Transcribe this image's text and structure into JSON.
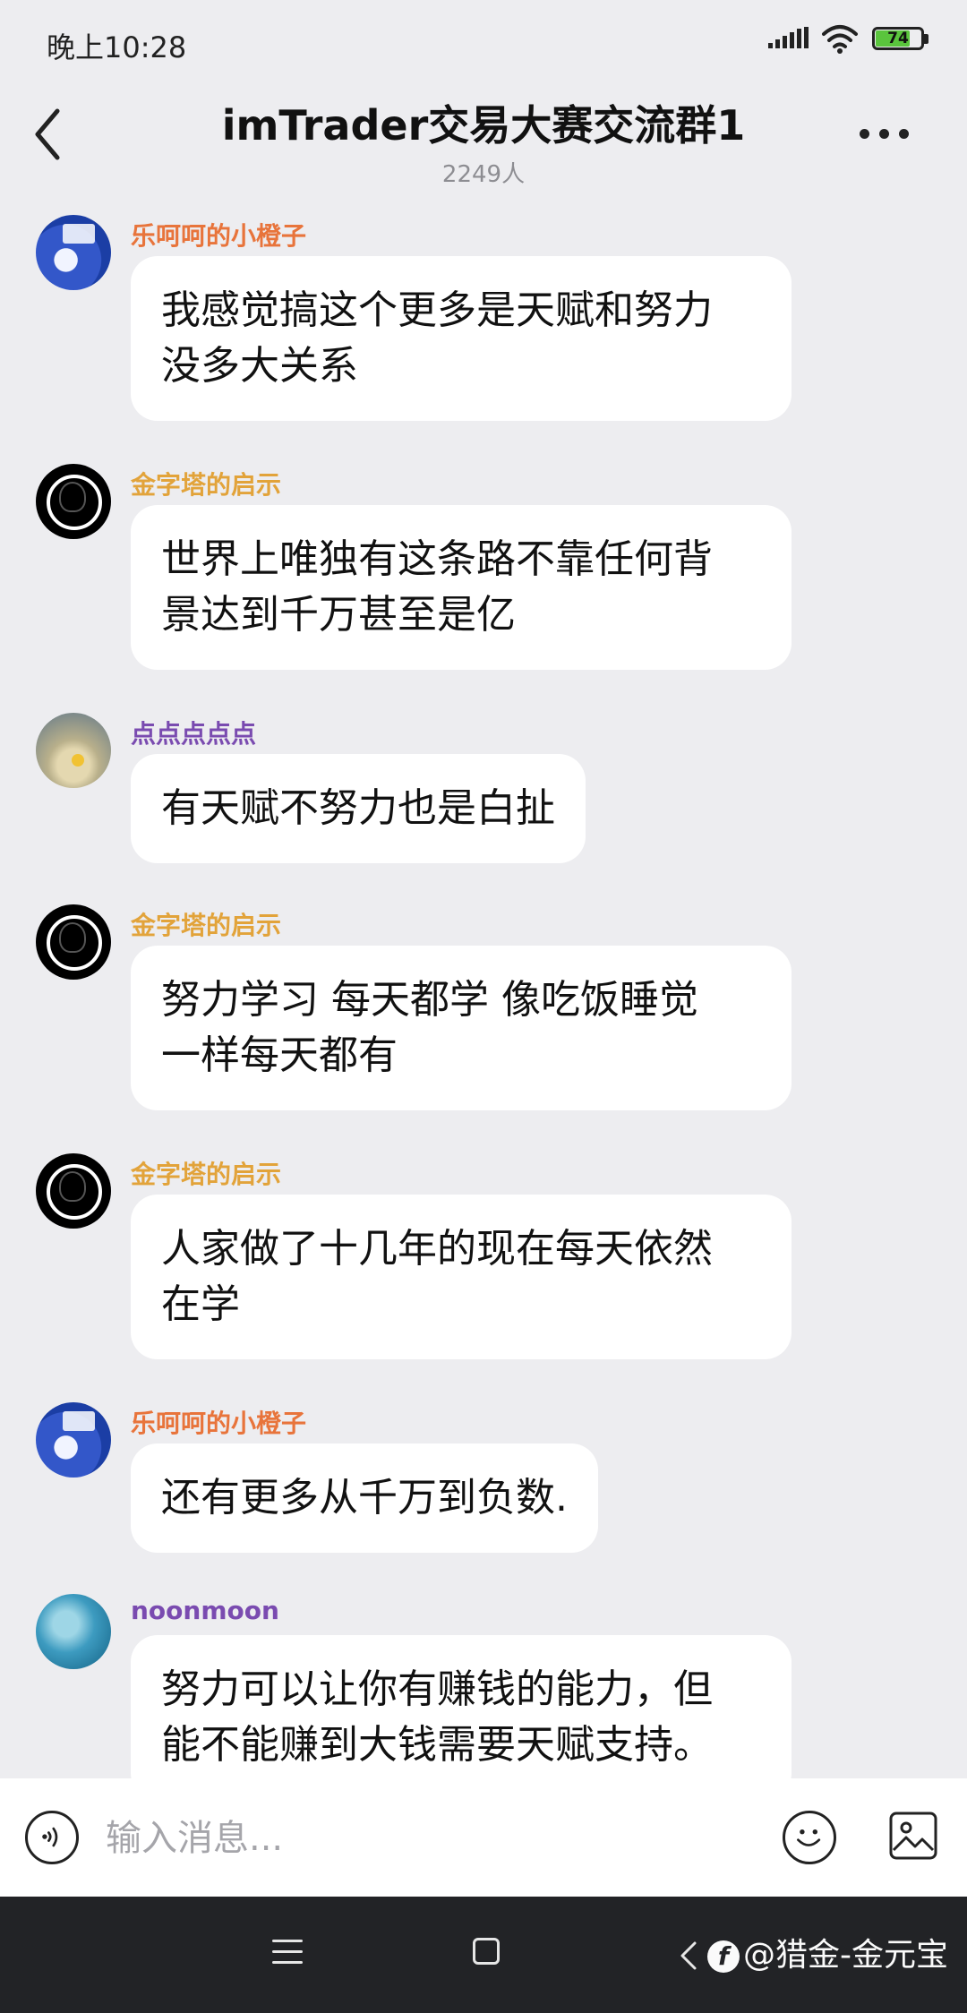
{
  "status_bar": {
    "time": "晚上10:28",
    "battery_level": "74",
    "battery_color": "#5ac53d"
  },
  "header": {
    "title": "imTrader交易大赛交流群1",
    "members": "2249人"
  },
  "messages": [
    {
      "sender": "乐呵呵的小橙子",
      "sender_color": "#e8743b",
      "avatar": "orange-avatar",
      "text_line1": "我感觉搞这个更多是天赋和努力",
      "text_line2": "没多大关系"
    },
    {
      "sender": "金字塔的启示",
      "sender_color": "#e2a33a",
      "avatar": "black-circle-avatar",
      "text_line1": "世界上唯独有这条路不靠任何背",
      "text_line2": "景达到千万甚至是亿"
    },
    {
      "sender": "点点点点点",
      "sender_color": "#7a4bb0",
      "avatar": "beige-avatar",
      "text_line1": "有天赋不努力也是白扯",
      "text_line2": ""
    },
    {
      "sender": "金字塔的启示",
      "sender_color": "#e2a33a",
      "avatar": "black-circle-avatar",
      "text_line1": "努力学习 每天都学 像吃饭睡觉",
      "text_line2": "一样每天都有"
    },
    {
      "sender": "金字塔的启示",
      "sender_color": "#e2a33a",
      "avatar": "black-circle-avatar",
      "text_line1": "人家做了十几年的现在每天依然",
      "text_line2": "在学"
    },
    {
      "sender": "乐呵呵的小橙子",
      "sender_color": "#e8743b",
      "avatar": "orange-avatar",
      "text_line1": "还有更多从千万到负数.",
      "text_line2": ""
    },
    {
      "sender": "noonmoon",
      "sender_color": "#7a4bb0",
      "avatar": "blue-avatar",
      "text_line1": "努力可以让你有赚钱的能力，但",
      "text_line2": "能不能赚到大钱需要天赋支持。"
    }
  ],
  "input": {
    "placeholder": "输入消息..."
  },
  "watermark": {
    "logo": "f",
    "text": "@猎金-金元宝"
  }
}
